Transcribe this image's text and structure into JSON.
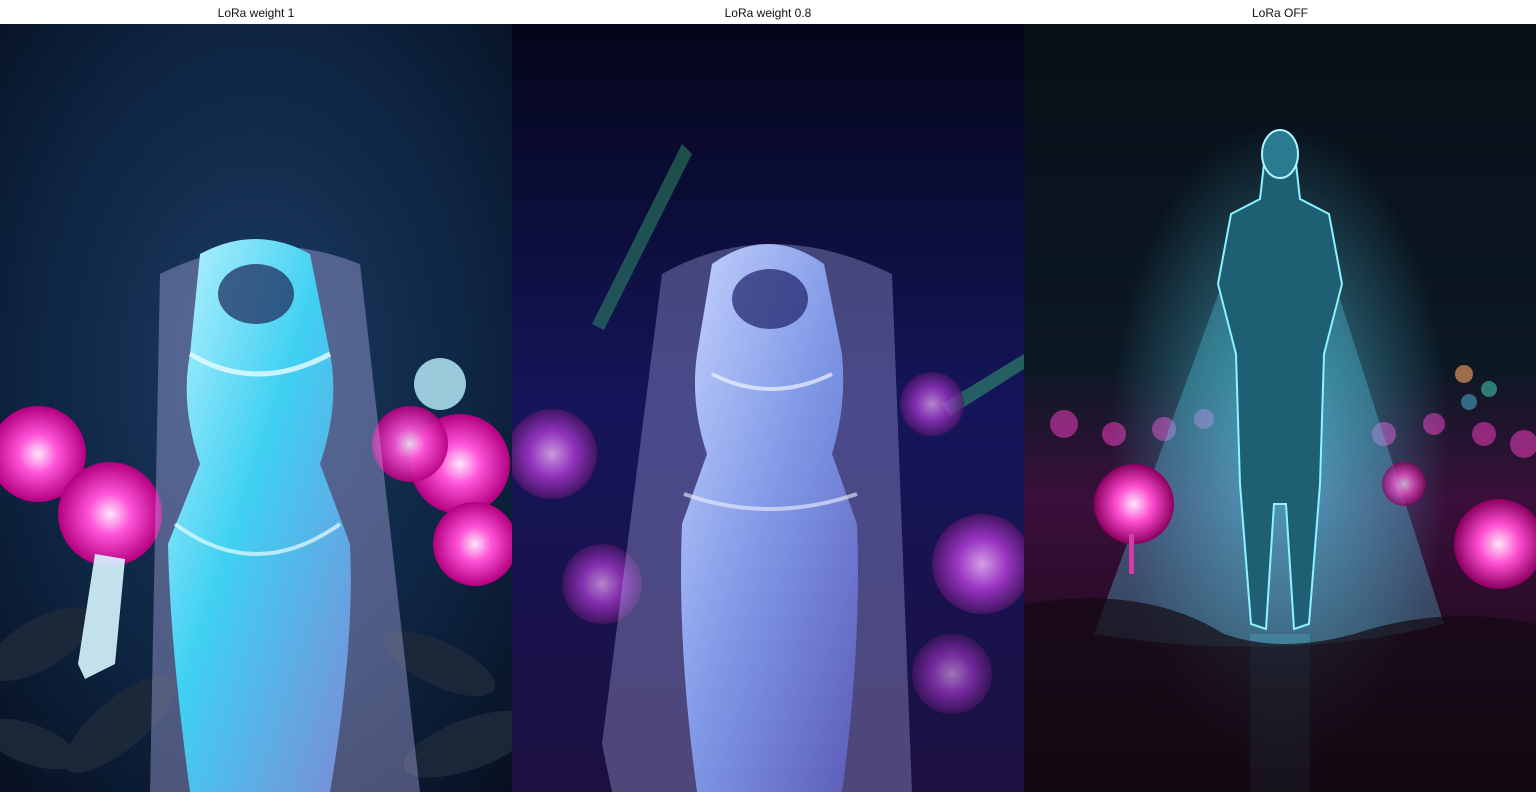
{
  "panels": [
    {
      "caption": "LoRa weight 1"
    },
    {
      "caption": "LoRa weight 0.8"
    },
    {
      "caption": "LoRa OFF"
    }
  ],
  "colors": {
    "background_dark": "#0a1a33",
    "glow_cyan": "#5fe3ff",
    "flower_magenta": "#ff2ec8",
    "veil_lavender": "#b9b5ff"
  }
}
